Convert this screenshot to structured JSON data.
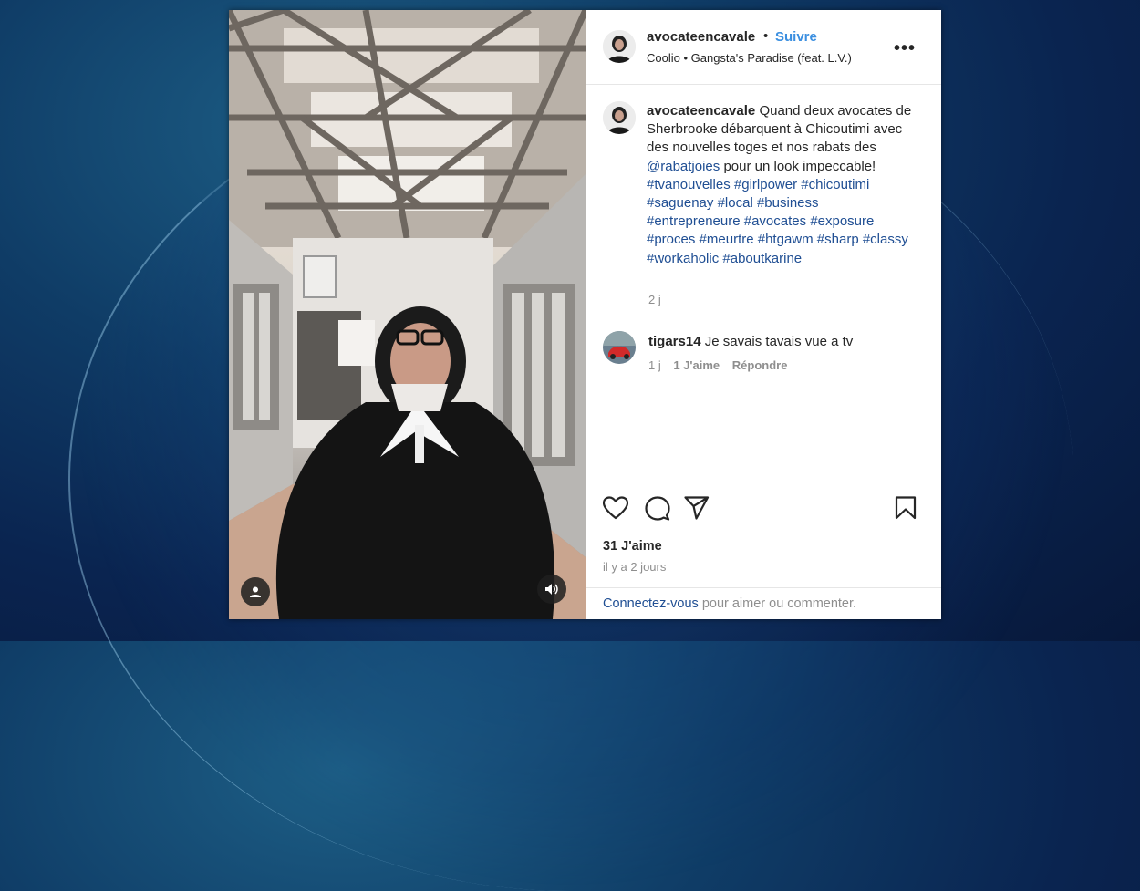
{
  "post": {
    "username": "avocateencavale",
    "separator": "•",
    "follow_label": "Suivre",
    "music": "Coolio • Gangsta's Paradise (feat. L.V.)",
    "more_label": "•••"
  },
  "caption": {
    "username": "avocateencavale",
    "text_1": "Quand deux avocates de Sherbrooke débarquent à Chicoutimi avec des nouvelles toges et nos rabats des",
    "mention": "@rabatjoies",
    "text_2": "pour un look impeccable!",
    "hashtags": [
      "#tvanouvelles",
      "#girlpower",
      "#chicoutimi",
      "#saguenay",
      "#local",
      "#business",
      "#entrepreneure",
      "#avocates",
      "#exposure",
      "#proces",
      "#meurtre",
      "#htgawm",
      "#sharp",
      "#classy",
      "#workaholic",
      "#aboutkarine"
    ],
    "time": "2 j"
  },
  "comment": {
    "username": "tigars14",
    "text": "Je savais tavais vue a tv",
    "time": "1 j",
    "likes": "1 J'aime",
    "reply_label": "Répondre"
  },
  "actions": {
    "likes_count": "31 J'aime",
    "posted_ago": "il y a 2 jours"
  },
  "login": {
    "link_label": "Connectez-vous",
    "text": "pour aimer ou commenter."
  },
  "colors": {
    "follow": "#3b8fe0",
    "tag": "#1f4e93",
    "muted": "#8e8e8e"
  }
}
